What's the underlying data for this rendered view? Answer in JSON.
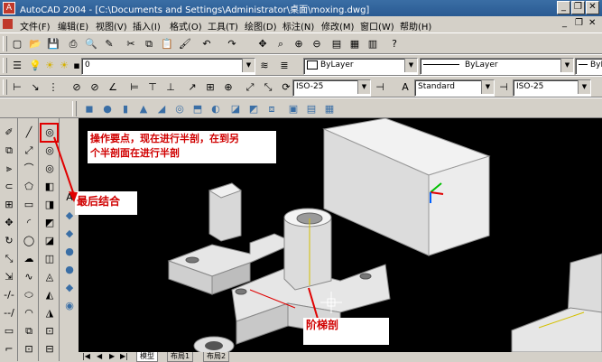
{
  "window": {
    "title": "AutoCAD 2004 - [C:\\Documents and Settings\\Administrator\\桌面\\moxing.dwg]",
    "minimize": "_",
    "restore": "❐",
    "close": "✕"
  },
  "menu": [
    "文件(F)",
    "编辑(E)",
    "视图(V)",
    "插入(I)",
    "格式(O)",
    "工具(T)",
    "绘图(D)",
    "标注(N)",
    "修改(M)",
    "窗口(W)",
    "帮助(H)"
  ],
  "layer_toolbar": {
    "layer_value": "0",
    "color_value": "ByLayer",
    "linetype_value": "ByLayer",
    "lineweight_value": "ByLayer"
  },
  "dim_toolbar": {
    "dimstyle_value": "ISO-25",
    "textstyle_value": "Standard",
    "dimstyle2_value": "ISO-25"
  },
  "annotations": {
    "note_top_line1": "操作要点，现在进行半剖，在到另",
    "note_top_line2": "个半剖面在进行半剖",
    "note_combine": "最后结合",
    "note_step": "阶梯剖"
  },
  "layout_tabs": {
    "model": "模型",
    "layout1": "布局1",
    "layout2": "布局2"
  },
  "colors": {
    "titlebar": "#3a6ea5",
    "highlight_box": "#e00000",
    "canvas": "#000000"
  }
}
